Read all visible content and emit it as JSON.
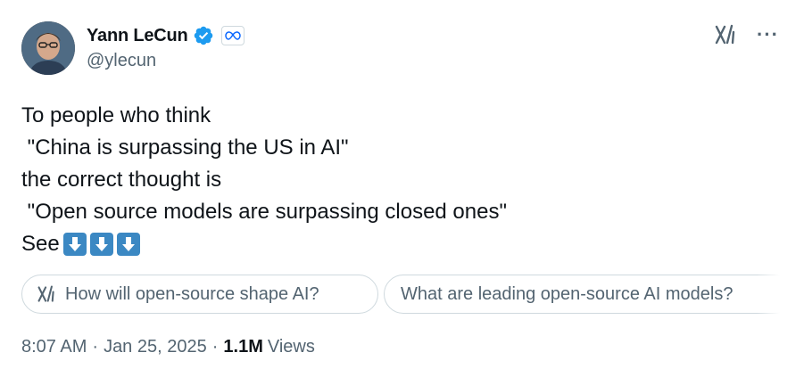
{
  "author": {
    "name": "Yann LeCun",
    "handle": "@ylecun",
    "verified_color": "#1d9bf0"
  },
  "tweet": {
    "lines": [
      "To people who think",
      " \"China is surpassing the US in AI\"",
      "the correct thought is",
      " \"Open source models are surpassing closed ones\""
    ],
    "see_label": "See",
    "emoji": [
      "down-arrow-emoji",
      "down-arrow-emoji",
      "down-arrow-emoji"
    ]
  },
  "suggestions": [
    {
      "label": "How will open-source shape AI?"
    },
    {
      "label": "What are leading open-source AI models?"
    }
  ],
  "meta": {
    "time": "8:07 AM",
    "date": "Jan 25, 2025",
    "separator": "·",
    "views_count": "1.1M",
    "views_label": "Views"
  },
  "icons": {
    "grok": "grok-icon",
    "more": "more-icon",
    "verified": "verified-badge-icon",
    "affiliation": "meta-affiliation-icon"
  },
  "colors": {
    "text": "#0f1419",
    "secondary": "#536471",
    "border": "#cfd9de",
    "emoji_blue": "#3b88c3"
  }
}
